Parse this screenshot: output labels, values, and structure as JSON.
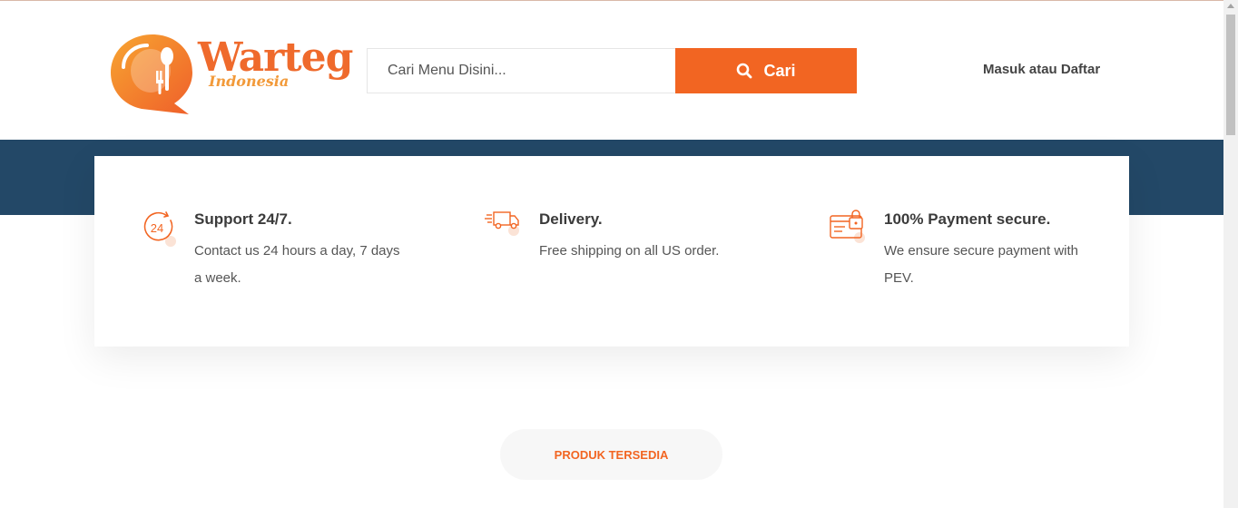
{
  "brand": {
    "name": "Warteg",
    "subtitle": "Indonesia",
    "accent_color": "#f26522",
    "navy_color": "#234867"
  },
  "search": {
    "placeholder": "Cari Menu Disini...",
    "button_label": "Cari",
    "icon": "search-icon"
  },
  "auth": {
    "login_label": "Masuk atau Daftar"
  },
  "features": [
    {
      "icon": "clock-24-icon",
      "title": "Support 24/7.",
      "description": "Contact us 24 hours a day, 7 days a week."
    },
    {
      "icon": "delivery-truck-icon",
      "title": "Delivery.",
      "description": "Free shipping on all US order."
    },
    {
      "icon": "secure-payment-icon",
      "title": "100% Payment secure.",
      "description": "We ensure secure payment with PEV."
    }
  ],
  "section": {
    "label": "PRODUK TERSEDIA"
  }
}
